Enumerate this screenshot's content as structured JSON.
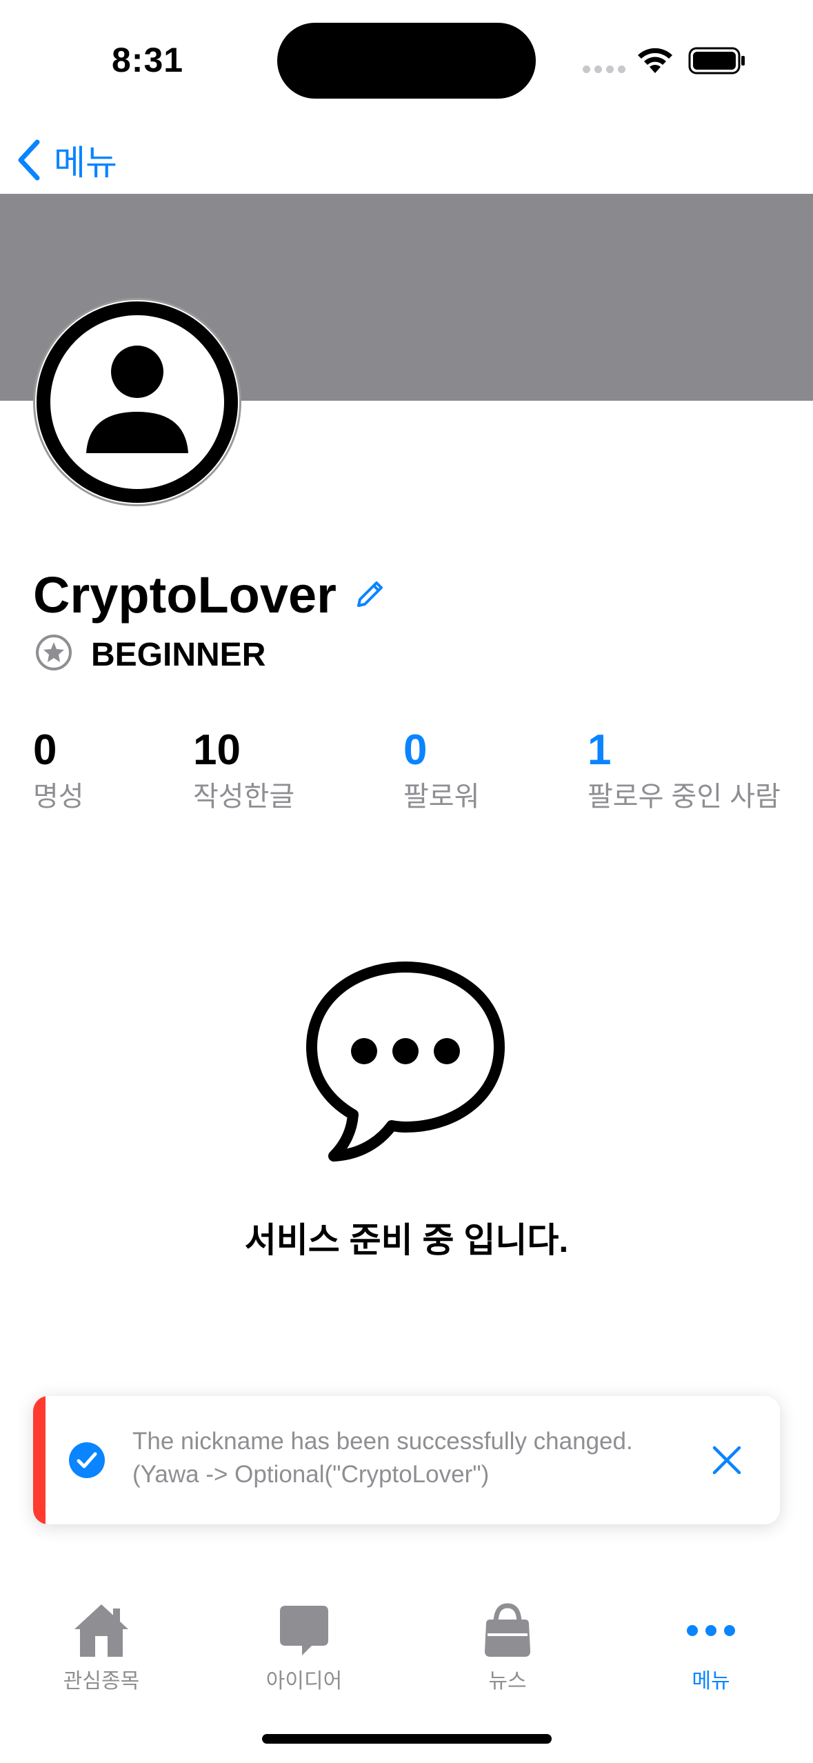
{
  "status_bar": {
    "time": "8:31"
  },
  "nav": {
    "back_label": "메뉴"
  },
  "profile": {
    "nickname": "CryptoLover",
    "level": "BEGINNER"
  },
  "stats": [
    {
      "value": "0",
      "label": "명성"
    },
    {
      "value": "10",
      "label": "작성한글"
    },
    {
      "value": "0",
      "label": "팔로워"
    },
    {
      "value": "1",
      "label": "팔로우 중인 사람"
    }
  ],
  "empty_state": {
    "message": "서비스 준비 중 입니다."
  },
  "toast": {
    "message": "The nickname has been successfully changed.(Yawa -> Optional(\"CryptoLover\")"
  },
  "tab_bar": [
    {
      "label": "관심종목",
      "icon": "house-icon"
    },
    {
      "label": "아이디어",
      "icon": "chat-bubble-icon"
    },
    {
      "label": "뉴스",
      "icon": "bag-icon"
    },
    {
      "label": "메뉴",
      "icon": "ellipsis-icon"
    }
  ],
  "colors": {
    "accent": "#0a84ff",
    "banner": "#8a8a8e",
    "toast_accent": "#ff3b30",
    "secondary_text": "#8e8e93"
  }
}
